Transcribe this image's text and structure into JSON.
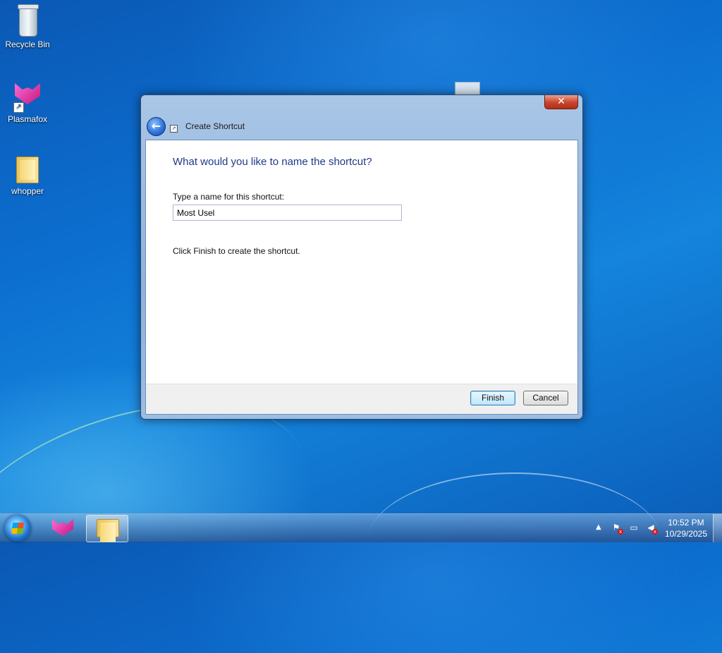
{
  "desktop": {
    "icons": [
      {
        "label": "Recycle Bin",
        "icon": "recycle-bin-icon"
      },
      {
        "label": "Plasmafox",
        "icon": "plasmafox-icon"
      },
      {
        "label": "whopper",
        "icon": "folder-icon"
      }
    ]
  },
  "dialog": {
    "title": "Create Shortcut",
    "close_glyph": "✕",
    "back_glyph": "←",
    "question": "What would you like to name the shortcut?",
    "name_label": "Type a name for this shortcut:",
    "name_value": "Most Usel",
    "finish_note": "Click Finish to create the shortcut.",
    "finish_label": "Finish",
    "cancel_label": "Cancel",
    "accent_color": "#1e3a8a"
  },
  "taskbar": {
    "pinned": [
      {
        "name": "start-button",
        "icon": "windows-logo-icon"
      },
      {
        "name": "plasmafox",
        "icon": "plasmafox-icon"
      },
      {
        "name": "windows-explorer",
        "icon": "folder-icon",
        "active": true
      }
    ],
    "tray": {
      "show_hidden_glyph": "▲",
      "icons": [
        "action-center-flag-icon",
        "network-icon",
        "volume-muted-icon"
      ]
    },
    "clock": {
      "time": "10:52 PM",
      "date": "10/29/2025"
    }
  }
}
